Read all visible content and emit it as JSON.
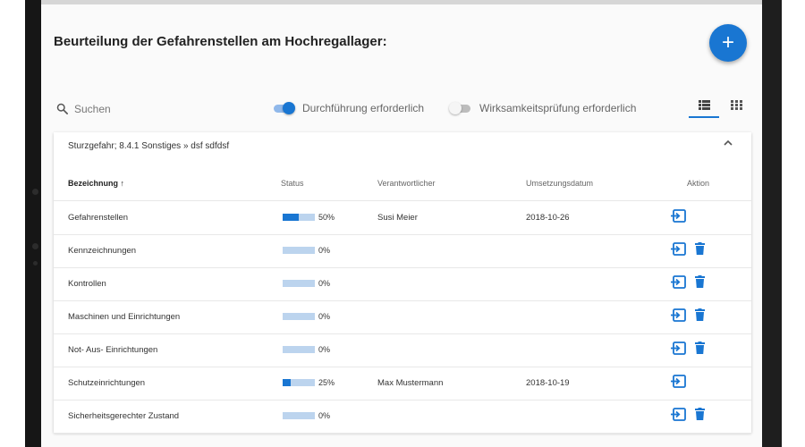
{
  "page": {
    "title": "Beurteilung der Gefahrenstellen am Hochregallager:",
    "fab_label": "+"
  },
  "toolbar": {
    "search_placeholder": "Suchen",
    "toggle1": {
      "label": "Durchführung erforderlich",
      "on": true
    },
    "toggle2": {
      "label": "Wirksamkeitsprüfung erforderlich",
      "on": false
    },
    "view_active": "list"
  },
  "panel": {
    "header": "Sturzgefahr; 8.4.1 Sonstiges » dsf sdfdsf",
    "collapse_icon": "^"
  },
  "columns": {
    "name": "Bezeichnung ↑",
    "status": "Status",
    "owner": "Verantwortlicher",
    "date": "Umsetzungsdatum",
    "action": "Aktion"
  },
  "rows": [
    {
      "name": "Gefahrenstellen",
      "progress": 0.5,
      "status_text": "50%",
      "owner": "Susi Meier",
      "date": "2018-10-26",
      "delete": false
    },
    {
      "name": "Kennzeichnungen",
      "progress": 0,
      "status_text": "0%",
      "owner": "",
      "date": "",
      "delete": true
    },
    {
      "name": "Kontrollen",
      "progress": 0,
      "status_text": "0%",
      "owner": "",
      "date": "",
      "delete": true
    },
    {
      "name": "Maschinen und Einrichtungen",
      "progress": 0,
      "status_text": "0%",
      "owner": "",
      "date": "",
      "delete": true
    },
    {
      "name": "Not- Aus- Einrichtungen",
      "progress": 0,
      "status_text": "0%",
      "owner": "",
      "date": "",
      "delete": true
    },
    {
      "name": "Schutzeinrichtungen",
      "progress": 0.25,
      "status_text": "25%",
      "owner": "Max Mustermann",
      "date": "2018-10-19",
      "delete": false
    },
    {
      "name": "Sicherheitsgerechter Zustand",
      "progress": 0,
      "status_text": "0%",
      "owner": "",
      "date": "",
      "delete": true
    }
  ],
  "colors": {
    "accent": "#1976d2",
    "bar_track": "#bcd4ee",
    "switch_on_track": "#90b8ea",
    "switch_off_track": "#bdbdbd"
  },
  "icons": {
    "open": "open-in-icon",
    "delete": "trash-icon",
    "search": "search-icon",
    "list": "list-view-icon",
    "grid": "grid-view-icon"
  }
}
